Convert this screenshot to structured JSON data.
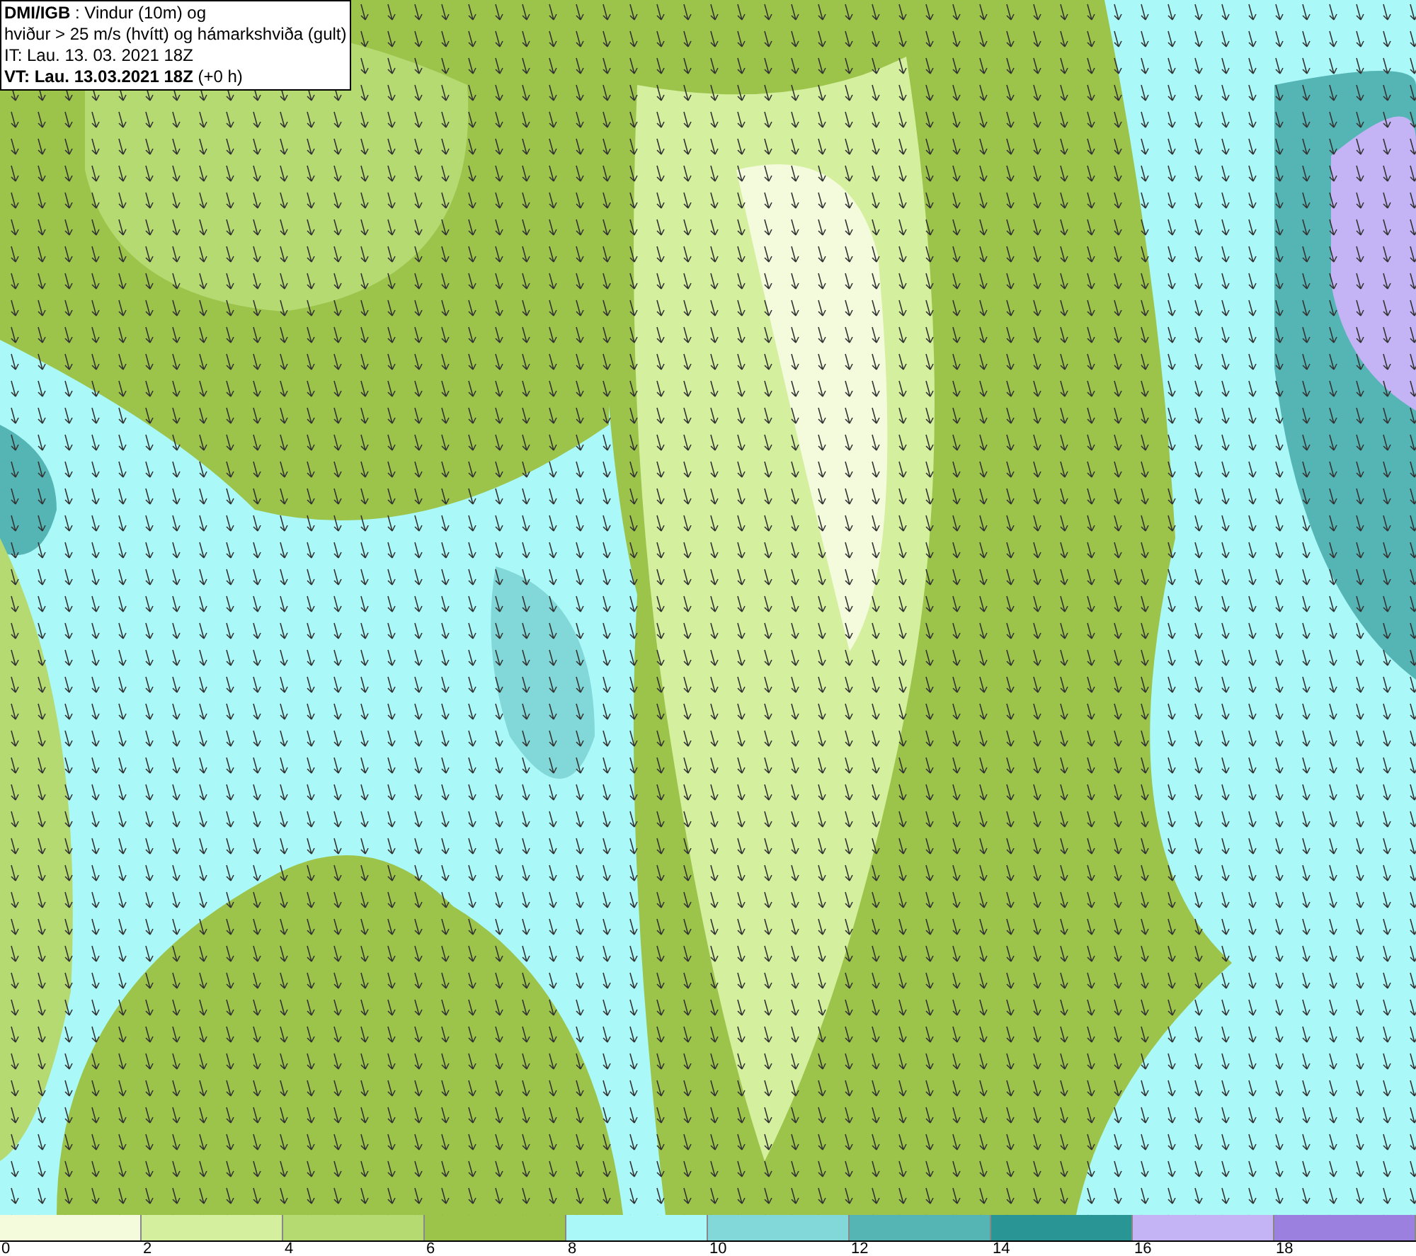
{
  "header": {
    "lines": [
      "**DMI/IGB** : Vindur (10m) og",
      "hviður > 25 m/s (hvítt) og hámarkshviða (gult)",
      "IT: Lau. 13. 03. 2021 18Z",
      "**VT: Lau. 13.03.2021 18Z** (+0 h)"
    ]
  },
  "legend": {
    "segments": [
      {
        "color": "#f4fbdc",
        "label": "0"
      },
      {
        "color": "#d4ef9e",
        "label": "2"
      },
      {
        "color": "#b6da72",
        "label": "4"
      },
      {
        "color": "#9cc44a",
        "label": "6"
      },
      {
        "color": "#aaf8f8",
        "label": "8"
      },
      {
        "color": "#82d8d8",
        "label": "10"
      },
      {
        "color": "#55b5b5",
        "label": "12"
      },
      {
        "color": "#2a9595",
        "label": "14"
      },
      {
        "color": "#c4b4f6",
        "label": "16"
      },
      {
        "color": "#9c80e0",
        "label": "18"
      }
    ]
  }
}
